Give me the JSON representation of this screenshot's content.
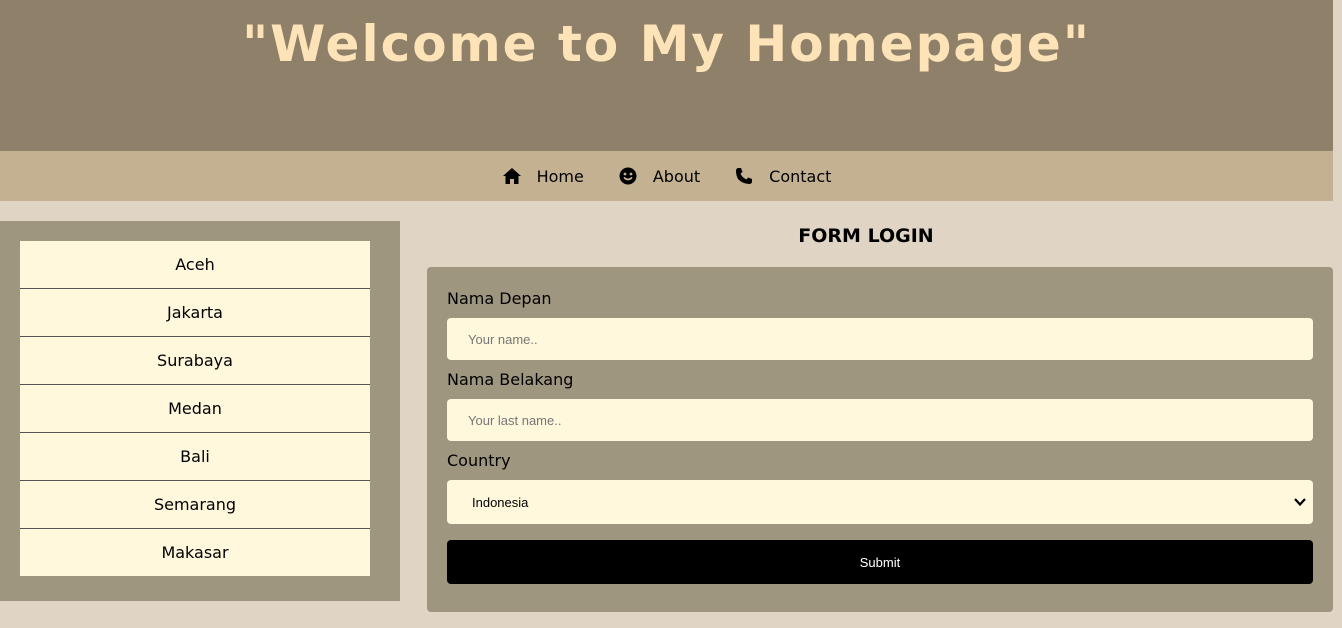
{
  "header": {
    "title": "\"Welcome to My Homepage\""
  },
  "nav": {
    "items": [
      {
        "label": "Home",
        "icon": "home-icon"
      },
      {
        "label": "About",
        "icon": "smile-icon"
      },
      {
        "label": "Contact",
        "icon": "phone-icon"
      }
    ]
  },
  "sidebar": {
    "items": [
      {
        "label": "Aceh"
      },
      {
        "label": "Jakarta"
      },
      {
        "label": "Surabaya"
      },
      {
        "label": "Medan"
      },
      {
        "label": "Bali"
      },
      {
        "label": "Semarang"
      },
      {
        "label": "Makasar"
      }
    ]
  },
  "form": {
    "title": "FORM LOGIN",
    "first_name": {
      "label": "Nama Depan",
      "placeholder": "Your name..",
      "value": ""
    },
    "last_name": {
      "label": "Nama Belakang",
      "placeholder": "Your last name..",
      "value": ""
    },
    "country": {
      "label": "Country",
      "selected": "Indonesia"
    },
    "submit_label": "Submit"
  },
  "colors": {
    "header_bg": "#8e8069",
    "title_text": "#ffe3b8",
    "nav_bg": "#c3b191",
    "page_bg": "#e0d5c5",
    "panel_bg": "#9e967f",
    "field_bg": "#fff8dd",
    "submit_bg": "#000000"
  }
}
